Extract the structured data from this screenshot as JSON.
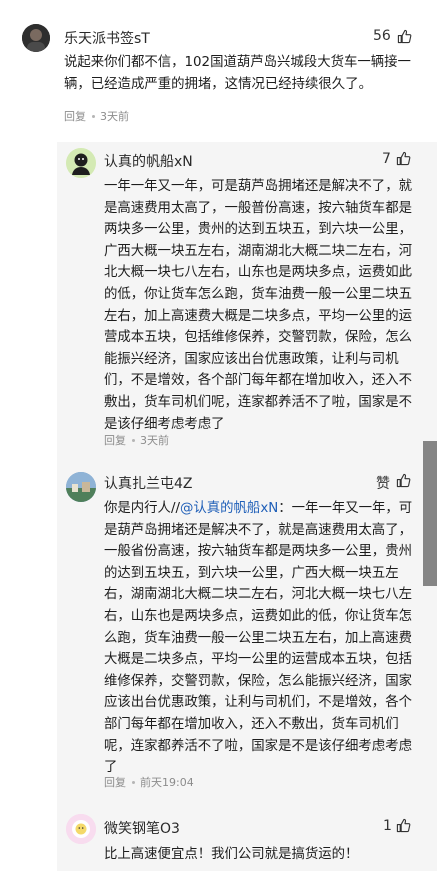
{
  "comments": [
    {
      "username": "乐天派书签sT",
      "likes": "56",
      "text": "说起来你们都不信，102国道葫芦岛兴城段大货车一辆接一辆，已经造成严重的拥堵，这情况已经持续很久了。",
      "reply_label": "回复",
      "time": "3天前"
    },
    {
      "username": "认真的帆船xN",
      "likes": "7",
      "text": "一年一年又一年，可是葫芦岛拥堵还是解决不了，就是高速费用太高了，一般普份高速，按六轴货车都是两块多一公里，贵州的达到五块五，到六块一公里，广西大概一块五左右，湖南湖北大概二块二左右，河北大概一块七八左右，山东也是两块多点，运费如此的低，你让货车怎么跑，货车油费一般一公里二块五左右，加上高速费大概是二块多点，平均一公里的运营成本五块，包括维修保养，交警罚款，保险，怎么能振兴经济，国家应该出台优惠政策，让利与司机们，不是增效，各个部门每年都在增加收入，还入不敷出，货车司机们呢，连家都养活不了啦，国家是不是该仔细考虑考虑了",
      "reply_label": "回复",
      "time": "3天前"
    },
    {
      "username": "认真扎兰屯4Z",
      "likes": "赞",
      "text_prefix": "你是内行人//",
      "mention": "@认真的帆船xN",
      "text": "：一年一年又一年，可是葫芦岛拥堵还是解决不了，就是高速费用太高了，一般省份高速，按六轴货车都是两块多一公里，贵州的达到五块五，到六块一公里，广西大概一块五左右，湖南湖北大概二块二左右，河北大概一块七八左右，山东也是两块多点，运费如此的低，你让货车怎么跑，货车油费一般一公里二块五左右，加上高速费大概是二块多点，平均一公里的运营成本五块，包括维修保养，交警罚款，保险，怎么能振兴经济，国家应该出台优惠政策，让利与司机们，不是增效，各个部门每年都在增加收入，还入不敷出，货车司机们呢，连家都养活不了啦，国家是不是该仔细考虑考虑了",
      "reply_label": "回复",
      "time": "前天19:04"
    },
    {
      "username": "微笑钢笔O3",
      "likes": "1",
      "text": "比上高速便宜点！我们公司就是搞货运的！"
    }
  ],
  "colors": {
    "thread_bg": "#f5f5f5",
    "mention": "#1f5fb8",
    "meta": "#8c8c8c",
    "scrollbar": "#858585"
  },
  "icons": [
    "thumbs-up-icon",
    "avatar"
  ]
}
